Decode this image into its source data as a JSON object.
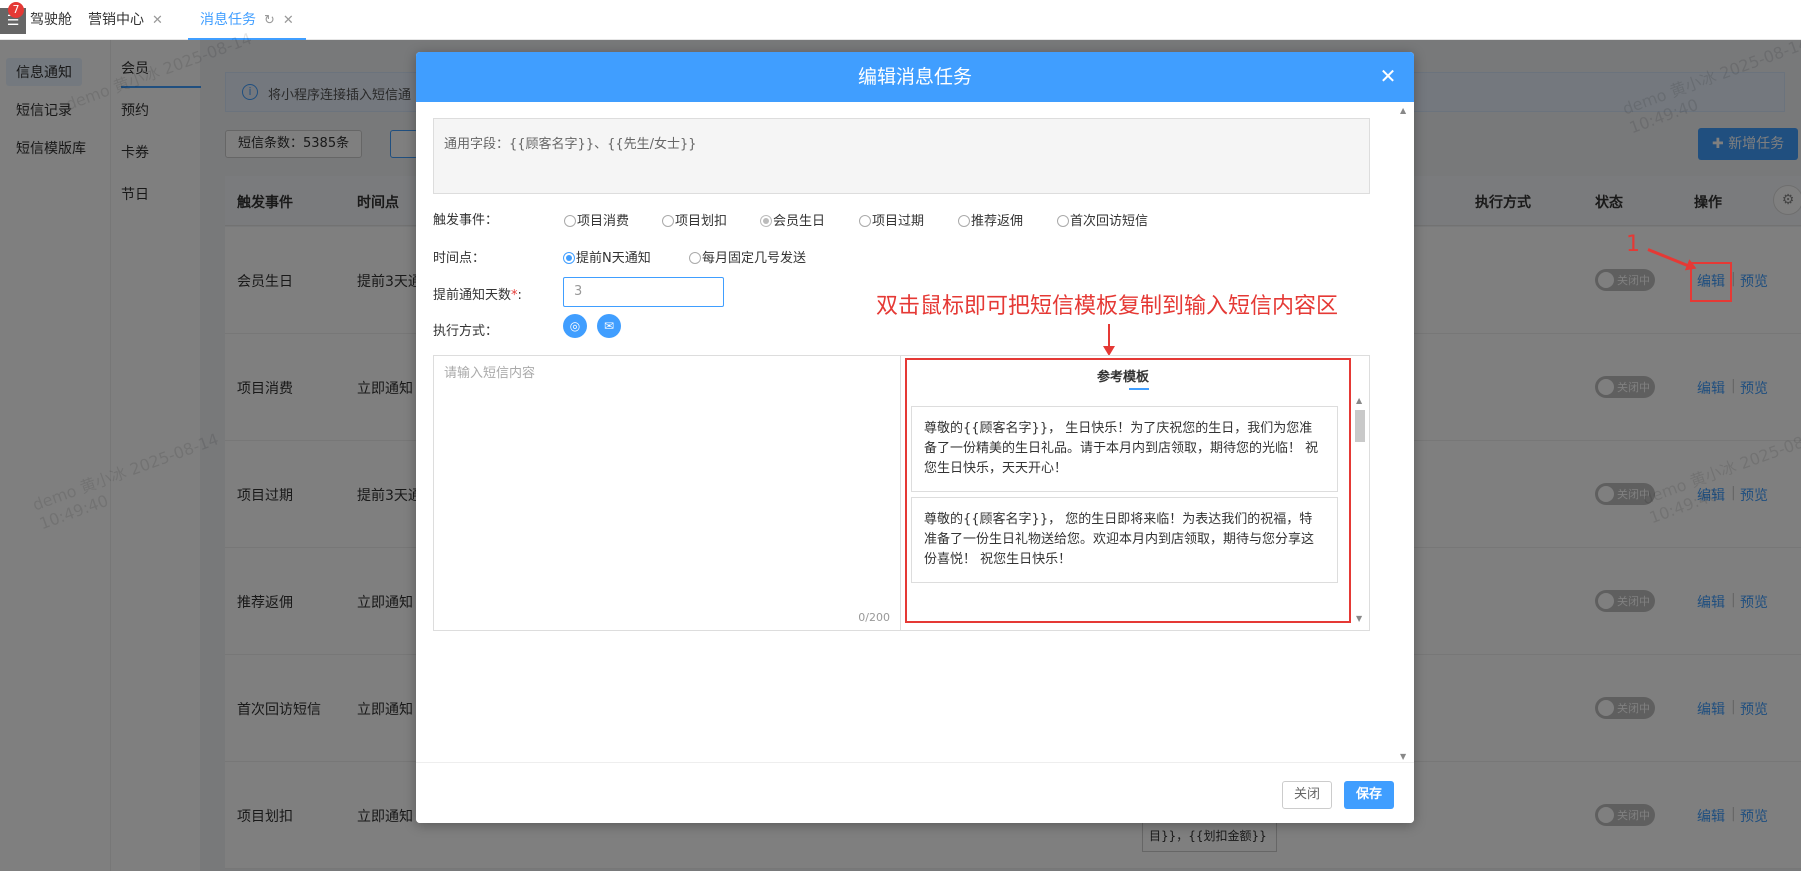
{
  "topbar": {
    "menu_badge": "7",
    "tabs": [
      {
        "label": "驾驶舱"
      },
      {
        "label": "营销中心"
      },
      {
        "label": "消息任务"
      }
    ]
  },
  "leftnav": {
    "items": [
      {
        "label": "信息通知"
      },
      {
        "label": "短信记录"
      },
      {
        "label": "短信模版库"
      }
    ]
  },
  "subnav": {
    "items": [
      {
        "label": "会员"
      },
      {
        "label": "预约"
      },
      {
        "label": "卡券"
      },
      {
        "label": "节日"
      }
    ]
  },
  "info": {
    "text": "将小程序连接插入短信通"
  },
  "sms_count": "短信条数：5385条",
  "add_task": "新增任务",
  "table": {
    "headers": {
      "event": "触发事件",
      "time": "时间点",
      "exec": "执行方式",
      "status": "状态",
      "ops": "操作"
    },
    "rows": [
      {
        "event": "会员生日",
        "time": "提前3天通",
        "status": "关闭中",
        "edit": "编辑",
        "preview": "预览"
      },
      {
        "event": "项目消费",
        "time": "立即通知",
        "status": "关闭中",
        "edit": "编辑",
        "preview": "预览"
      },
      {
        "event": "项目过期",
        "time": "提前3天通",
        "status": "关闭中",
        "edit": "编辑",
        "preview": "预览"
      },
      {
        "event": "推荐返佣",
        "time": "立即通知",
        "status": "关闭中",
        "edit": "编辑",
        "preview": "预览"
      },
      {
        "event": "首次回访短信",
        "time": "立即通知",
        "status": "关闭中",
        "edit": "编辑",
        "preview": "预览"
      },
      {
        "event": "项目划扣",
        "time": "立即通知",
        "status": "关闭中",
        "edit": "编辑",
        "preview": "预览"
      }
    ],
    "behind_textarea": "目}}，{{划扣金额}}"
  },
  "annotations": {
    "step_number": "1",
    "note": "双击鼠标即可把短信模板复制到输入短信内容区"
  },
  "watermark": {
    "line1": "demo 黄小冰 2025-08-14",
    "line2": "10:49:40"
  },
  "modal": {
    "title": "编辑消息任务",
    "common_fields": "通用字段：{{顾客名字}}、{{先生/女士}}",
    "trigger_label": "触发事件：",
    "trigger_options": [
      {
        "label": "项目消费"
      },
      {
        "label": "项目划扣"
      },
      {
        "label": "会员生日"
      },
      {
        "label": "项目过期"
      },
      {
        "label": "推荐返佣"
      },
      {
        "label": "首次回访短信"
      }
    ],
    "time_label": "时间点：",
    "time_options": [
      {
        "label": "提前N天通知"
      },
      {
        "label": "每月固定几号发送"
      }
    ],
    "days_label": "提前通知天数",
    "days_required": "*",
    "days_colon": ":",
    "days_value": "3",
    "exec_label": "执行方式：",
    "sms_placeholder": "请输入短信内容",
    "sms_counter": "0/200",
    "template_tab": "参考模板",
    "templates": [
      {
        "text": "尊敬的{{顾客名字}}， 生日快乐！为了庆祝您的生日，我们为您准备了一份精美的生日礼品。请于本月内到店领取，期待您的光临！ 祝您生日快乐，天天开心！"
      },
      {
        "text": "尊敬的{{顾客名字}}， 您的生日即将来临！为表达我们的祝福，特准备了一份生日礼物送给您。欢迎本月内到店领取，期待与您分享这份喜悦！ 祝您生日快乐！"
      }
    ],
    "close_btn": "关闭",
    "save_btn": "保存"
  }
}
